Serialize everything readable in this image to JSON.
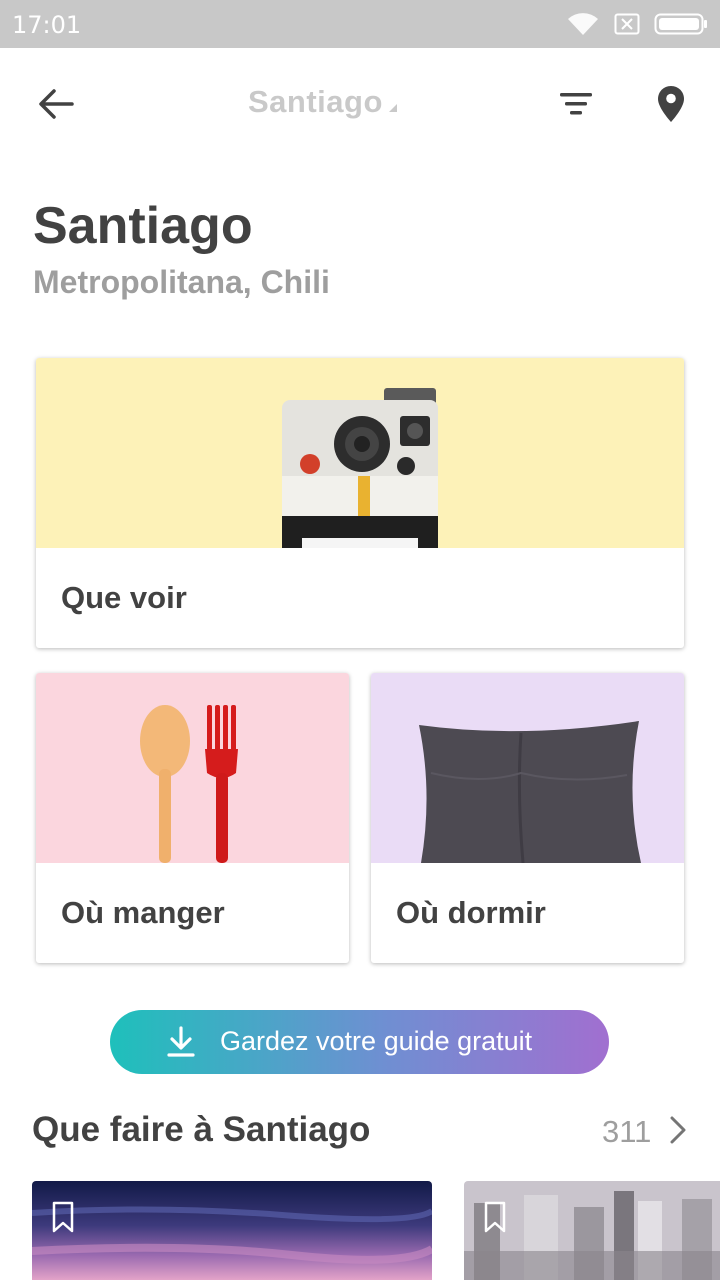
{
  "status_bar": {
    "time": "17:01",
    "icons": [
      "wifi-icon",
      "sim-icon",
      "battery-icon"
    ]
  },
  "app_bar": {
    "title": "Santiago",
    "icons": [
      "back-arrow-icon",
      "filter-icon",
      "map-pin-icon"
    ]
  },
  "header": {
    "city": "Santiago",
    "region": "Metropolitana, Chili"
  },
  "categories": [
    {
      "label": "Que voir",
      "image": "polaroid-camera",
      "color": "#fdf2b8"
    },
    {
      "label": "Où manger",
      "image": "spoon-and-fork",
      "color": "#fbd6de"
    },
    {
      "label": "Où dormir",
      "image": "pillow",
      "color": "#eadcf6"
    }
  ],
  "cta": {
    "label": "Gardez votre guide gratuit",
    "icon": "download-icon"
  },
  "section": {
    "title": "Que faire à Santiago",
    "count": "311"
  },
  "thumbnails": [
    {
      "image": "sunset-sky",
      "bookmark_icon": "bookmark-icon"
    },
    {
      "image": "city-skyline",
      "bookmark_icon": "bookmark-icon"
    }
  ],
  "colors": {
    "text_primary": "#424242",
    "text_secondary": "#9e9e9e",
    "cta_start": "#1ec0bb",
    "cta_end": "#a16fd0"
  }
}
